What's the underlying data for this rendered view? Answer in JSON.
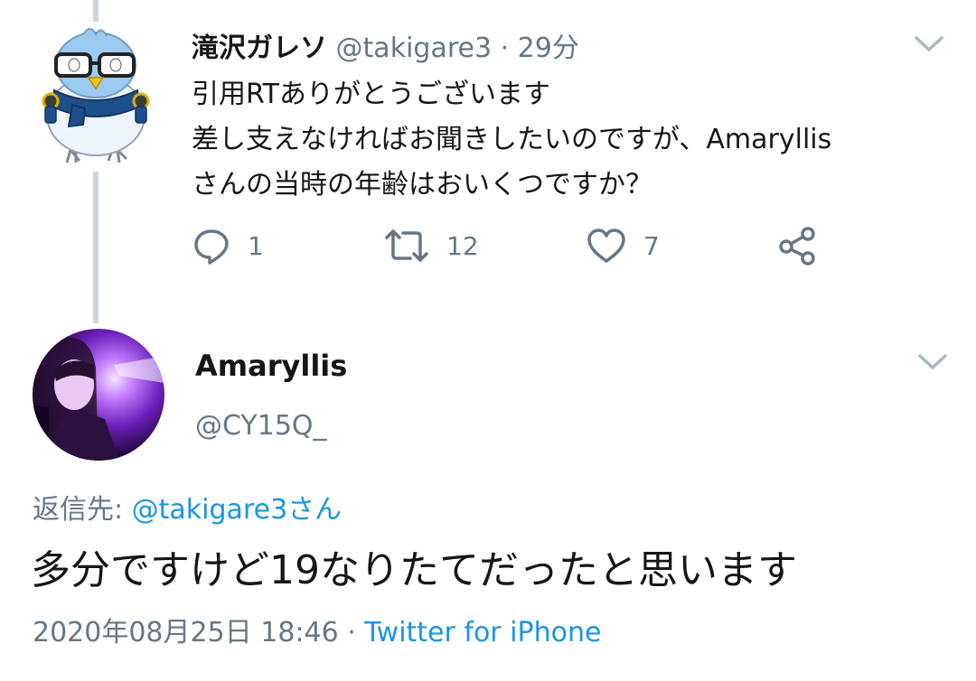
{
  "colors": {
    "text": "#14171a",
    "secondary": "#657786",
    "link": "#1b95e0",
    "thread_line": "#ccd6dd"
  },
  "parent_tweet": {
    "display_name": "滝沢ガレソ",
    "handle": "@takigare3",
    "separator": " · ",
    "time": "29分",
    "lines": [
      "引用RTありがとうございます",
      "差し支えなければお聞きしたいのですが、Amaryllis",
      "さんの当時の年齢はおいくつですか？"
    ],
    "actions": {
      "reply_icon": "reply-icon",
      "reply_count": "1",
      "retweet_icon": "retweet-icon",
      "retweet_count": "12",
      "like_icon": "heart-icon",
      "like_count": "7",
      "share_icon": "share-icon"
    }
  },
  "reply_tweet": {
    "display_name": "Amaryllis",
    "handle": "@CY15Q_",
    "reply_label": "返信先: ",
    "reply_mention": "@takigare3さん",
    "text": "多分ですけど19なりたてだったと思います",
    "date": "2020年08月25日 18:46",
    "separator": " · ",
    "source": "Twitter for iPhone"
  }
}
